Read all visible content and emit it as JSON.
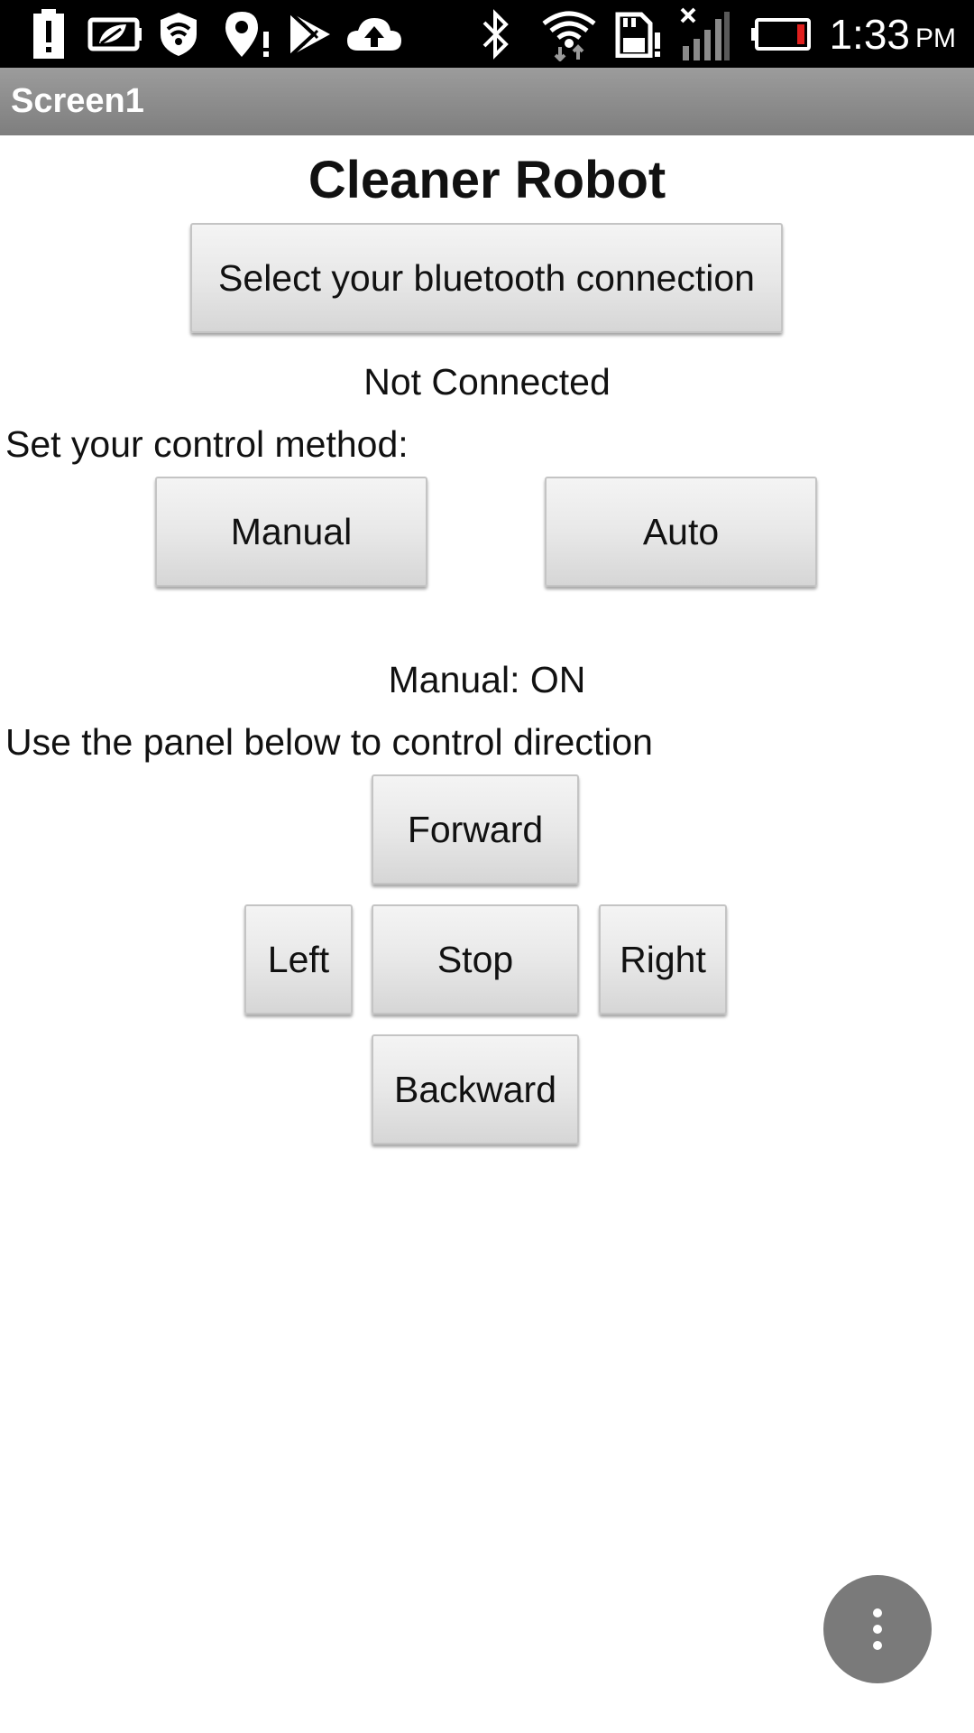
{
  "status_bar": {
    "time": "1:33",
    "ampm": "PM",
    "icons": [
      "alert-icon",
      "leaf-battery-icon",
      "shield-wifi-icon",
      "location-alert-icon",
      "play-store-icon",
      "cloud-upload-icon",
      "bluetooth-icon",
      "wifi-icon",
      "sd-card-alert-icon",
      "no-signal-icon",
      "battery-low-icon"
    ],
    "battery_color": "#e0201e"
  },
  "app_bar": {
    "title": "Screen1"
  },
  "main": {
    "heading": "Cleaner Robot",
    "bluetooth_button": "Select your bluetooth connection",
    "connection_status": "Not Connected",
    "control_method_label": "Set your control method:",
    "manual_button": "Manual",
    "auto_button": "Auto",
    "mode_status": "Manual: ON",
    "direction_hint": "Use the panel below to control direction",
    "direction_pad": {
      "forward": "Forward",
      "left": "Left",
      "stop": "Stop",
      "right": "Right",
      "backward": "Backward"
    }
  },
  "overflow_menu": {
    "icon": "more-vert-icon"
  }
}
